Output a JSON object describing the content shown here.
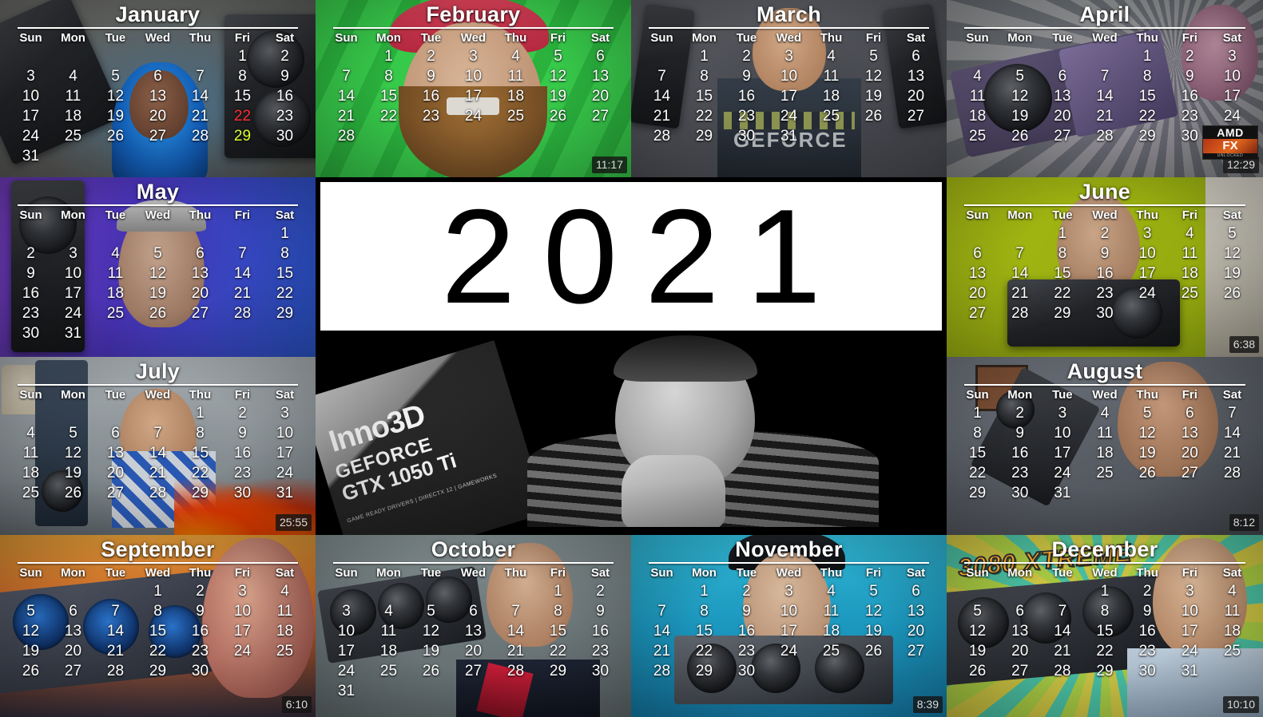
{
  "center": {
    "year_label": "2021",
    "photo_caption_brand": "Inno3D",
    "photo_caption_line2": "GEFORCE",
    "photo_caption_line3": "GTX 1050 Ti",
    "photo_caption_line4": "GAME READY DRIVERS | DIRECTX 12 | GAMEWORKS"
  },
  "weekday_labels": [
    "Sun",
    "Mon",
    "Tue",
    "Wed",
    "Thu",
    "Fri",
    "Sat"
  ],
  "months": [
    {
      "name": "January",
      "lead_blank": 5,
      "days": 31,
      "time_badge": "",
      "highlights": {
        "22": "red",
        "29": "yellow"
      },
      "theme": {
        "bg": "#6d6f6c",
        "accent": "#2ea5ff"
      },
      "overlay_text": ""
    },
    {
      "name": "February",
      "lead_blank": 1,
      "days": 28,
      "time_badge": "11:17",
      "highlights": {},
      "theme": {
        "bg": "#35d14a",
        "accent": "#f0455c"
      },
      "overlay_text": ""
    },
    {
      "name": "March",
      "lead_blank": 1,
      "days": 31,
      "time_badge": "",
      "highlights": {},
      "theme": {
        "bg": "#62646b",
        "accent": "#30343c"
      },
      "overlay_text": "GEFORCE"
    },
    {
      "name": "April",
      "lead_blank": 4,
      "days": 30,
      "time_badge": "12:29",
      "highlights": {},
      "theme": {
        "bg": "#3a3d42",
        "accent": "#8f5fa8"
      },
      "overlay_text": "",
      "logo": {
        "top": "AMD",
        "mid": "FX",
        "bottom": "UNLOCKED"
      }
    },
    {
      "name": "May",
      "lead_blank": 6,
      "days": 31,
      "time_badge": "",
      "highlights": {},
      "theme": {
        "bg": "#6a4fd0",
        "accent": "#2f5fe0"
      },
      "overlay_text": ""
    },
    {
      "name": "June",
      "lead_blank": 2,
      "days": 30,
      "time_badge": "6:38",
      "highlights": {},
      "theme": {
        "bg": "#b4cc13",
        "accent": "#8fa30c"
      },
      "overlay_text": ""
    },
    {
      "name": "July",
      "lead_blank": 4,
      "days": 31,
      "time_badge": "25:55",
      "highlights": {},
      "theme": {
        "bg": "#9ba3a8",
        "accent": "#2b64c4"
      },
      "overlay_text": ""
    },
    {
      "name": "August",
      "lead_blank": 0,
      "days": 31,
      "time_badge": "8:12",
      "highlights": {},
      "theme": {
        "bg": "#6d7078",
        "accent": "#3a3f47"
      },
      "overlay_text": ""
    },
    {
      "name": "September",
      "lead_blank": 3,
      "days": 30,
      "time_badge": "6:10",
      "highlights": {},
      "theme": {
        "bg": "#e8922c",
        "accent": "#1a5fd0"
      },
      "overlay_text": ""
    },
    {
      "name": "October",
      "lead_blank": 5,
      "days": 31,
      "time_badge": "",
      "highlights": {},
      "theme": {
        "bg": "#7d8a8c",
        "accent": "#2c3340"
      },
      "overlay_text": ""
    },
    {
      "name": "November",
      "lead_blank": 1,
      "days": 30,
      "time_badge": "8:39",
      "highlights": {},
      "theme": {
        "bg": "#2ec3e8",
        "accent": "#1b8fc4"
      },
      "overlay_text": ""
    },
    {
      "name": "December",
      "lead_blank": 3,
      "days": 31,
      "time_badge": "10:10",
      "highlights": {},
      "theme": {
        "bg": "#a8d94a",
        "accent": "#3ec9c0"
      },
      "overlay_text": "3080 XTREME"
    }
  ]
}
